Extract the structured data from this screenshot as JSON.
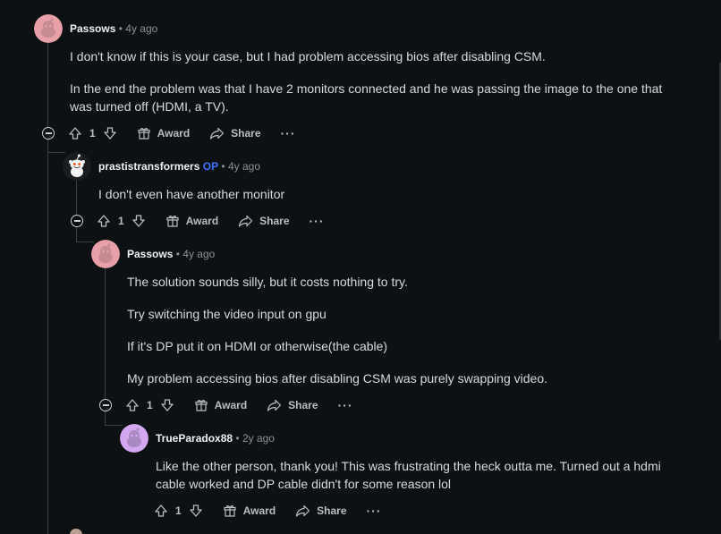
{
  "comments": [
    {
      "author": "Passows",
      "dot": "•",
      "time": "4y ago",
      "avatar_color": "#e8a0a8",
      "paragraphs": [
        "I don't know if this is your case, but I had problem accessing bios after disabling CSM.",
        "In the end the problem was that I have 2 monitors connected and he was passing the image to the one that",
        "was turned off (HDMI, a TV)."
      ],
      "votes": "1",
      "award_label": "Award",
      "share_label": "Share",
      "more_label": "···"
    },
    {
      "author": "prastistransformers",
      "op_badge": "OP",
      "dot": "•",
      "time": "4y ago",
      "avatar_color": "#f4f4f4",
      "paragraphs": [
        "I don't even have another monitor"
      ],
      "votes": "1",
      "award_label": "Award",
      "share_label": "Share",
      "more_label": "···"
    },
    {
      "author": "Passows",
      "dot": "•",
      "time": "4y ago",
      "avatar_color": "#e8a0a8",
      "paragraphs": [
        "The solution sounds silly, but it costs nothing to try.",
        "Try switching the video input on gpu",
        "If it's DP put it on HDMI or otherwise(the cable)",
        "My problem accessing bios after disabling CSM was purely swapping video."
      ],
      "votes": "1",
      "award_label": "Award",
      "share_label": "Share",
      "more_label": "···"
    },
    {
      "author": "TrueParadox88",
      "dot": "•",
      "time": "2y ago",
      "avatar_color": "#d4a8f0",
      "paragraphs": [
        "Like the other person, thank you! This was frustrating the heck outta me. Turned out a hdmi",
        "cable worked and DP cable didn't for some reason lol"
      ],
      "votes": "1",
      "award_label": "Award",
      "share_label": "Share",
      "more_label": "···"
    }
  ],
  "colors": {
    "background": "#0e1113",
    "thread_line": "#3a3f42",
    "op_badge": "#3f72ff"
  },
  "icons": [
    "upvote-icon",
    "downvote-icon",
    "award-icon",
    "share-icon",
    "collapse-icon",
    "more-icon",
    "snoo-avatar-icon"
  ]
}
